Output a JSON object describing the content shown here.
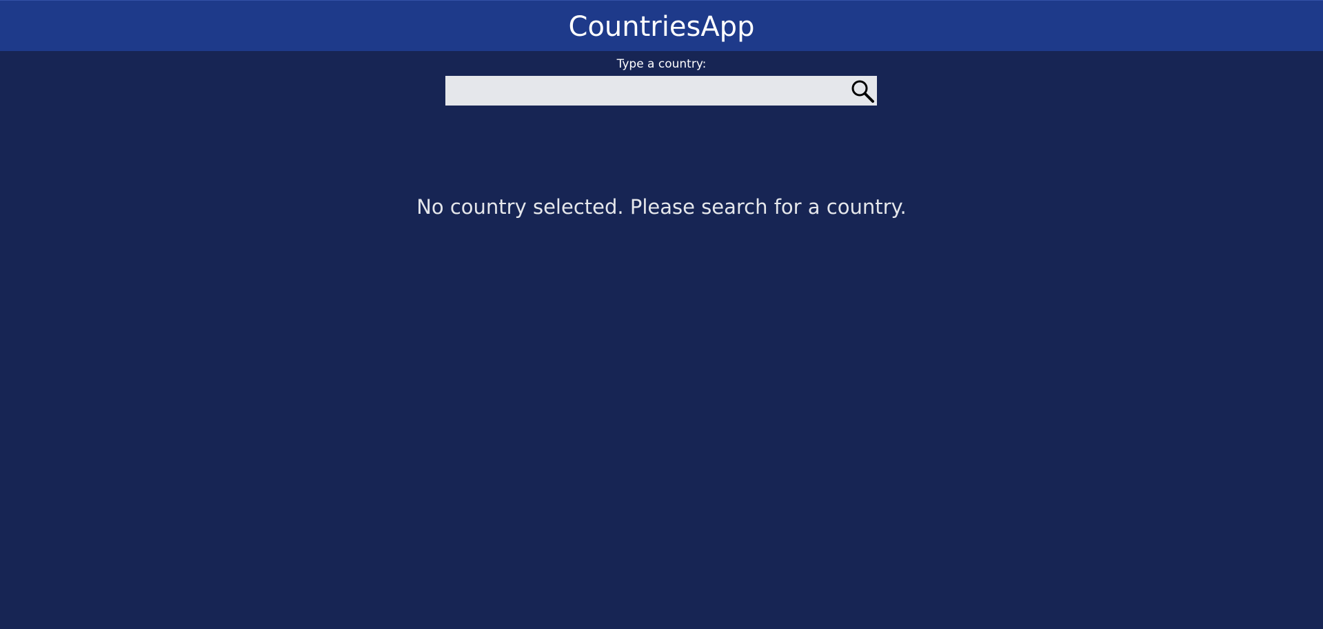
{
  "header": {
    "title": "CountriesApp"
  },
  "search": {
    "label": "Type a country:",
    "value": "",
    "placeholder": "",
    "button_icon": "search-icon"
  },
  "main": {
    "empty_message": "No country selected. Please search for a country."
  },
  "colors": {
    "header_background": "#1e3a8a",
    "page_background": "#172554",
    "input_background": "#e5e7eb",
    "text": "#ffffff"
  }
}
